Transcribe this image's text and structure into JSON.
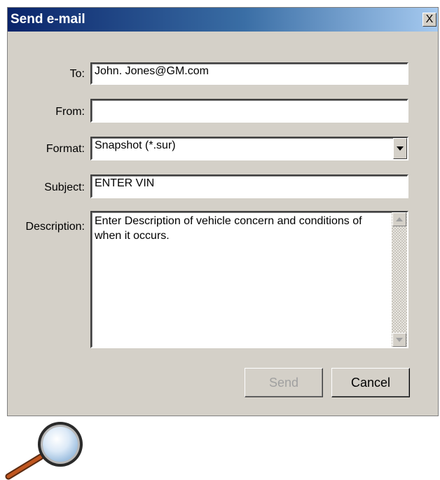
{
  "window": {
    "title": "Send e-mail",
    "close_glyph": "X"
  },
  "form": {
    "to_label": "To:",
    "to_value": "John. Jones@GM.com",
    "from_label": "From:",
    "from_value": "",
    "format_label": "Format:",
    "format_value": "Snapshot (*.sur)",
    "subject_label": "Subject:",
    "subject_value": "ENTER VIN",
    "description_label": "Description:",
    "description_value": "Enter Description of vehicle concern and conditions of when it occurs."
  },
  "buttons": {
    "send_label": "Send",
    "cancel_label": "Cancel"
  },
  "colors": {
    "title_bar_start": "#0a246a",
    "title_bar_end": "#a6caf0",
    "dialog_face": "#d4d0c8",
    "magnifier_handle": "#b04a1a"
  },
  "icons": [
    "close-icon",
    "dropdown-arrow-icon",
    "scroll-up-icon",
    "scroll-down-icon",
    "magnifier-icon"
  ]
}
